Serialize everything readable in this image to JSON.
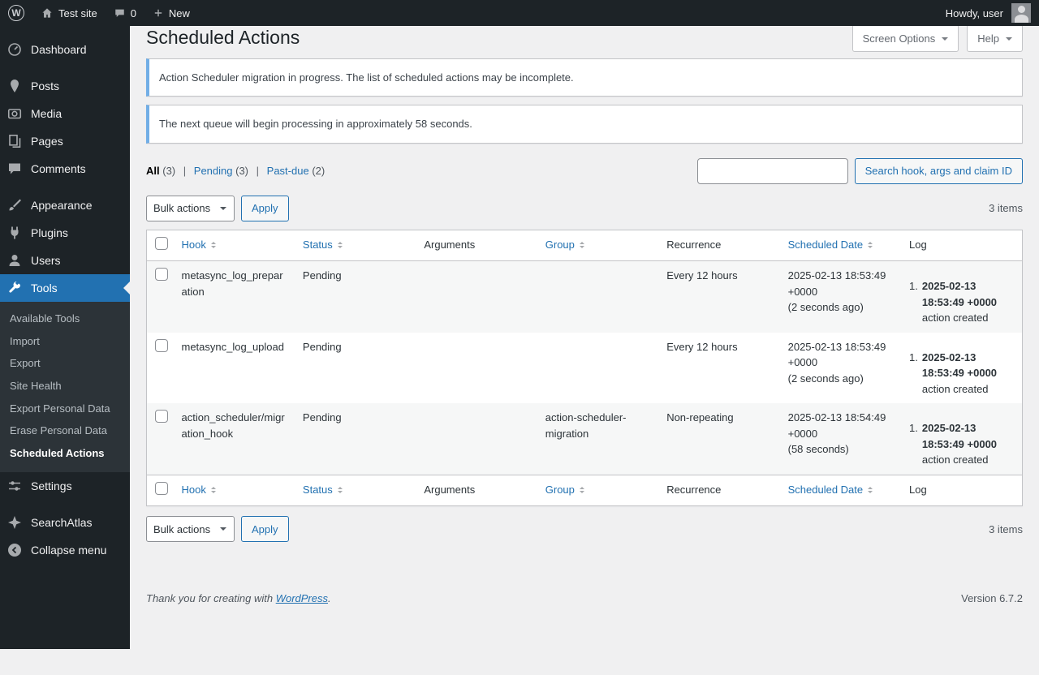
{
  "colors": {
    "accent": "#2271b1",
    "admin_dark": "#1d2327",
    "notice_info_border": "#72aee6"
  },
  "admin_bar": {
    "wp_logo_letter": "W",
    "site_name": "Test site",
    "comments_count": "0",
    "new_label": "New",
    "howdy": "Howdy, user"
  },
  "sidebar": {
    "dashboard": "Dashboard",
    "posts": "Posts",
    "media": "Media",
    "pages": "Pages",
    "comments": "Comments",
    "appearance": "Appearance",
    "plugins": "Plugins",
    "users": "Users",
    "tools": "Tools",
    "settings": "Settings",
    "searchatlas": "SearchAtlas",
    "collapse": "Collapse menu",
    "tools_submenu": [
      "Available Tools",
      "Import",
      "Export",
      "Site Health",
      "Export Personal Data",
      "Erase Personal Data",
      "Scheduled Actions"
    ]
  },
  "screen_meta": {
    "screen_options": "Screen Options",
    "help": "Help"
  },
  "page": {
    "title": "Scheduled Actions"
  },
  "notices": [
    "Action Scheduler migration in progress. The list of scheduled actions may be incomplete.",
    "The next queue will begin processing in approximately 58 seconds."
  ],
  "filters": {
    "all_label": "All",
    "all_count": "(3)",
    "pending_label": "Pending",
    "pending_count": "(3)",
    "pastdue_label": "Past-due",
    "pastdue_count": "(2)",
    "separator": "|"
  },
  "search": {
    "button_label": "Search hook, args and claim ID"
  },
  "tablenav": {
    "bulk_label": "Bulk actions",
    "apply_label": "Apply",
    "items_count": "3 items"
  },
  "table": {
    "columns": [
      "Hook",
      "Status",
      "Arguments",
      "Group",
      "Recurrence",
      "Scheduled Date",
      "Log"
    ],
    "rows": [
      {
        "hook": "metasync_log_preparation",
        "status": "Pending",
        "arguments": "",
        "group": "",
        "recurrence": "Every 12 hours",
        "scheduled_date": "2025-02-13 18:53:49 +0000",
        "scheduled_ago": "(2 seconds ago)",
        "log_num": "1.",
        "log_date": "2025-02-13 18:53:49 +0000",
        "log_text": "action created"
      },
      {
        "hook": "metasync_log_upload",
        "status": "Pending",
        "arguments": "",
        "group": "",
        "recurrence": "Every 12 hours",
        "scheduled_date": "2025-02-13 18:53:49 +0000",
        "scheduled_ago": "(2 seconds ago)",
        "log_num": "1.",
        "log_date": "2025-02-13 18:53:49 +0000",
        "log_text": "action created"
      },
      {
        "hook": "action_scheduler/migration_hook",
        "status": "Pending",
        "arguments": "",
        "group": "action-scheduler-migration",
        "recurrence": "Non-repeating",
        "scheduled_date": "2025-02-13 18:54:49 +0000",
        "scheduled_ago": "(58 seconds)",
        "log_num": "1.",
        "log_date": "2025-02-13 18:53:49 +0000",
        "log_text": "action created"
      }
    ]
  },
  "footer": {
    "thankyou_prefix": "Thank you for creating with ",
    "wordpress_link": "WordPress",
    "suffix": ".",
    "version": "Version 6.7.2"
  }
}
